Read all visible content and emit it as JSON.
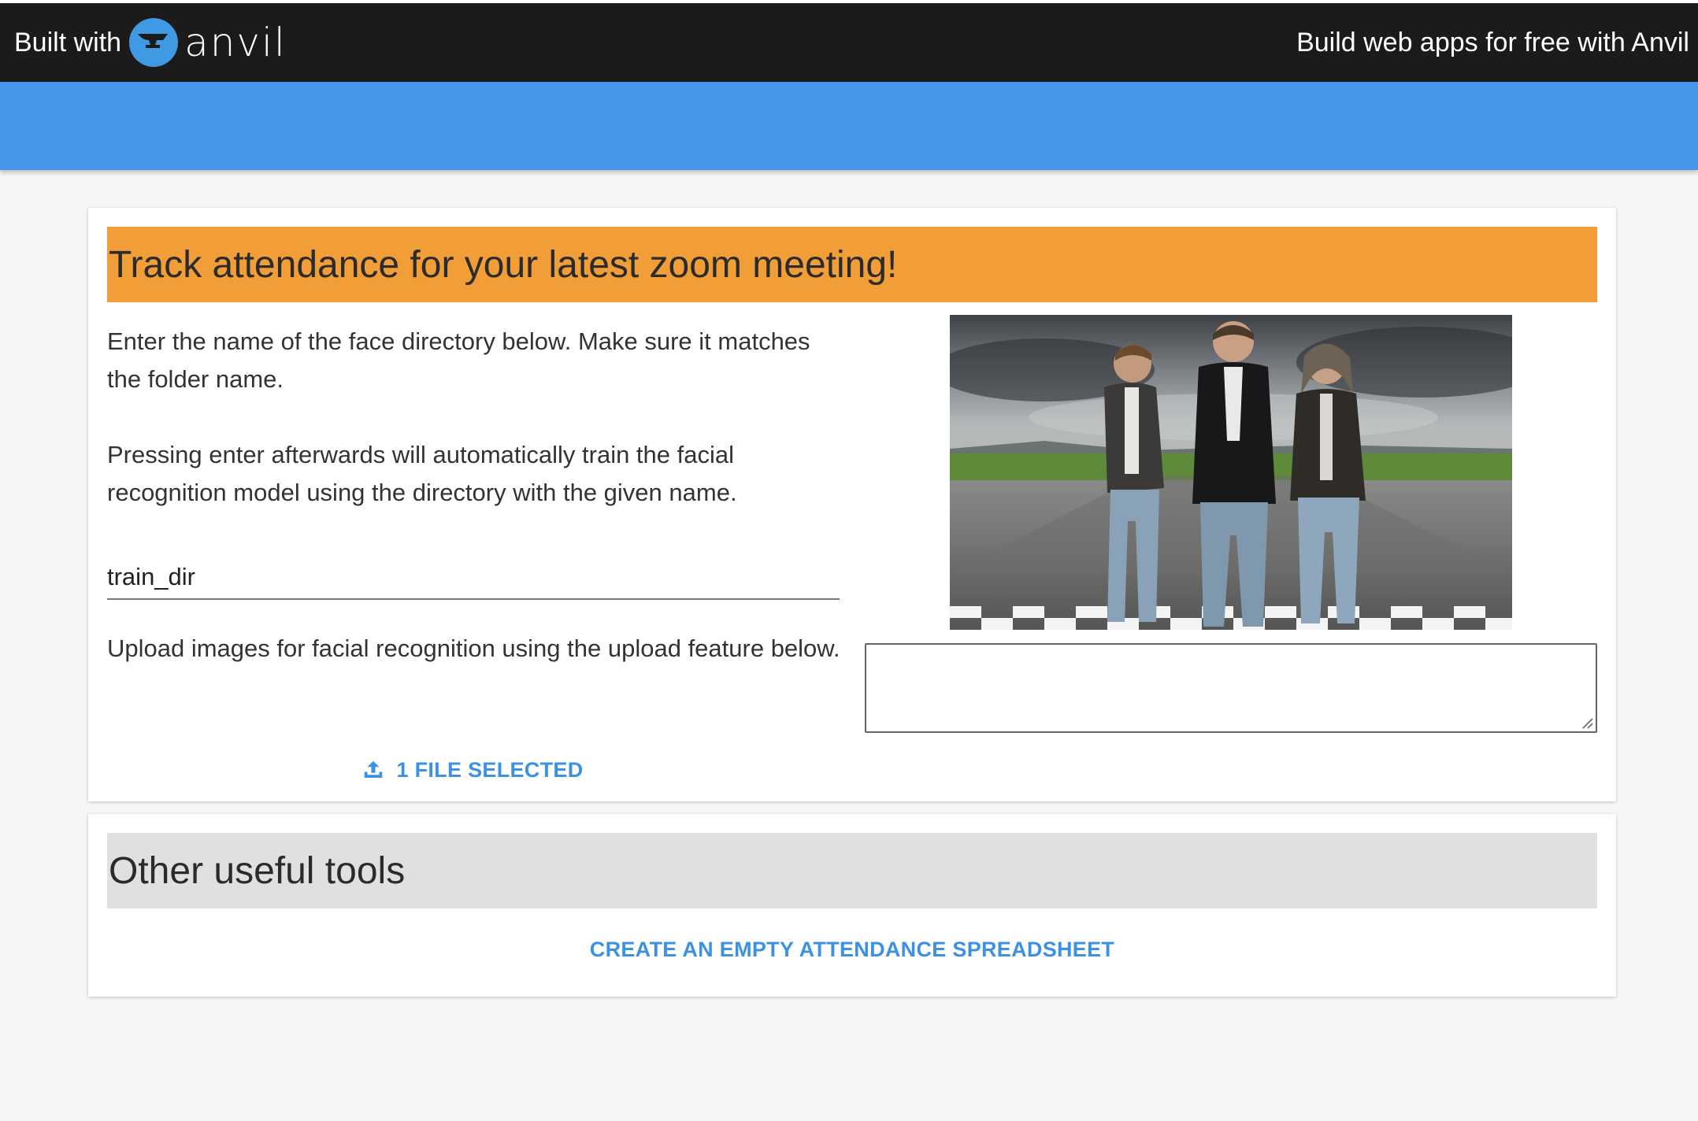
{
  "banner": {
    "built_with": "Built with",
    "logo_word": "anvil",
    "build_link": "Build web apps for free with Anvil"
  },
  "main_card": {
    "heading": "Track attendance for your latest zoom meeting!",
    "para1": "Enter the name of the face directory below. Make sure it matches the folder name.",
    "para2": "Pressing enter afterwards will automatically train the facial recognition model using the directory with the given name.",
    "dir_input_value": "train_dir",
    "para3": "Upload images for facial recognition using the upload feature below.",
    "upload_label": "1 FILE SELECTED",
    "output_textarea_value": ""
  },
  "tools_card": {
    "heading": "Other useful tools",
    "spreadsheet_button": "CREATE AN EMPTY ATTENDANCE SPREADSHEET"
  },
  "colors": {
    "topbar": "#1b1b1b",
    "header_blue": "#4596eb",
    "heading_orange": "#f19d38",
    "heading_grey": "#e0e0e0",
    "link_blue": "#3d91e4",
    "logo_blue": "#3f9ae3"
  },
  "icons": {
    "logo": "anvil-logo-icon",
    "upload": "upload-icon",
    "photo": "three-men-on-runway-image"
  }
}
